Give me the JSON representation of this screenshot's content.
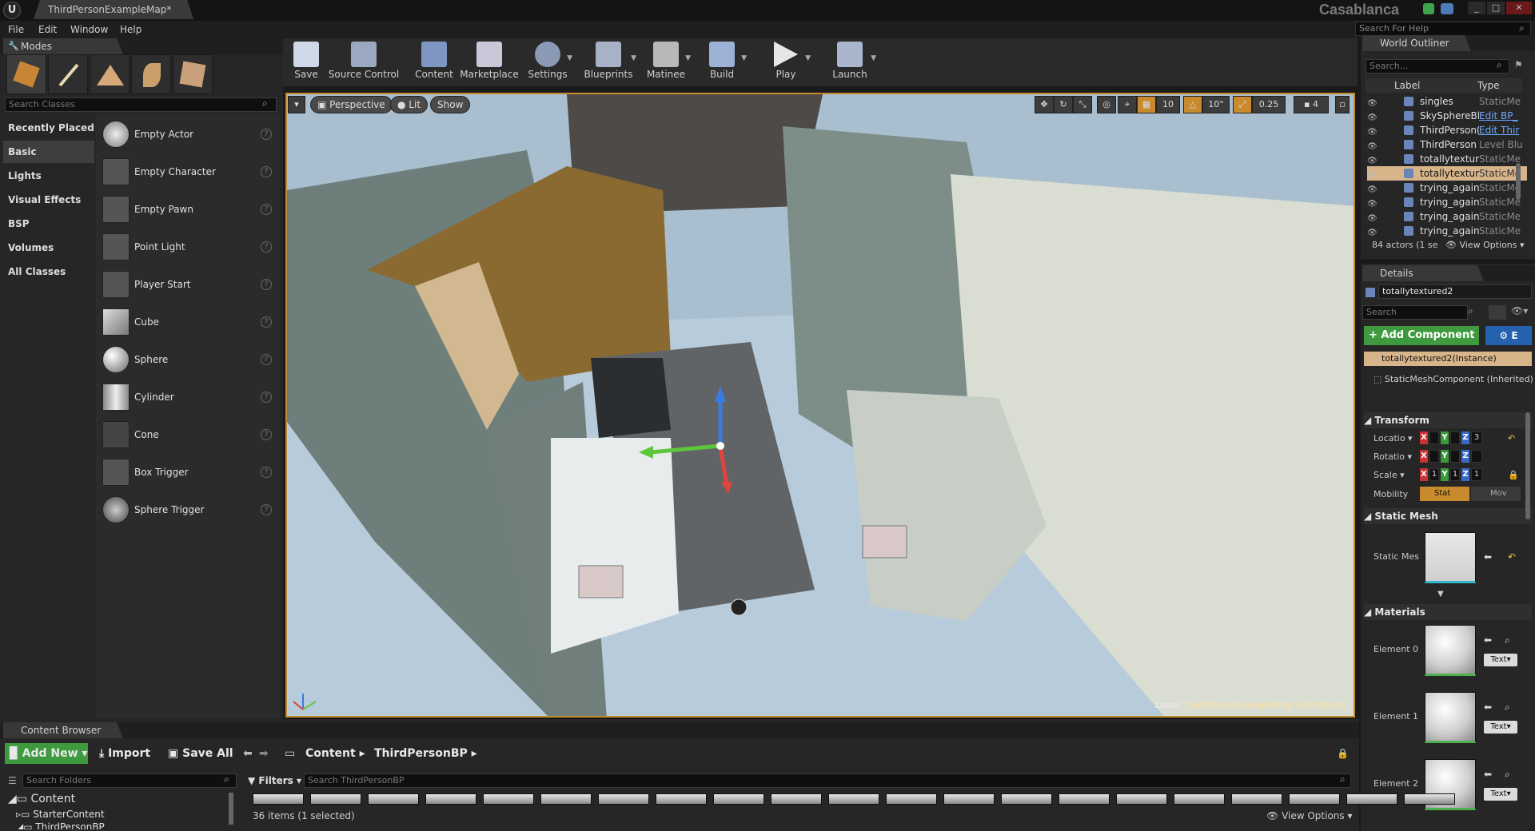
{
  "titlebar": {
    "logo": "U",
    "doc_tab": "ThirdPersonExampleMap*",
    "project": "Casablanca",
    "win_min": "_",
    "win_max": "□",
    "win_close": "✕"
  },
  "menu": {
    "items": [
      "File",
      "Edit",
      "Window",
      "Help"
    ],
    "search_placeholder": "Search For Help"
  },
  "modes": {
    "tab": "Modes",
    "search_placeholder": "Search Classes",
    "categories": [
      "Recently Placed",
      "Basic",
      "Lights",
      "Visual Effects",
      "BSP",
      "Volumes",
      "All Classes"
    ],
    "items": [
      "Empty Actor",
      "Empty Character",
      "Empty Pawn",
      "Point Light",
      "Player Start",
      "Cube",
      "Sphere",
      "Cylinder",
      "Cone",
      "Box Trigger",
      "Sphere Trigger"
    ],
    "help": "?"
  },
  "toolbar": {
    "buttons": [
      "Save",
      "Source Control",
      "Content",
      "Marketplace",
      "Settings",
      "Blueprints",
      "Matinee",
      "Build",
      "Play",
      "Launch"
    ]
  },
  "viewport": {
    "perspective": "Perspective",
    "lit": "Lit",
    "show": "Show",
    "grid_snap": "10",
    "rot_snap": "10°",
    "scale_snap": "0.25",
    "cam_speed": "4",
    "level_label": "Level:",
    "level_name": "ThirdPersonExampleMap (Persistent)"
  },
  "outliner": {
    "tab": "World Outliner",
    "search_placeholder": "Search...",
    "col_label": "Label",
    "col_type": "Type",
    "rows": [
      {
        "name": "singles",
        "type": "StaticMe"
      },
      {
        "name": "SkySphereBl",
        "type": "Edit BP_"
      },
      {
        "name": "ThirdPerson(",
        "type": "Edit Thir"
      },
      {
        "name": "ThirdPerson",
        "type": "Level Blu"
      },
      {
        "name": "totallytexture",
        "type": "StaticMe"
      },
      {
        "name": "totallytexture",
        "type": "StaticMe"
      },
      {
        "name": "trying_again",
        "type": "StaticMe"
      },
      {
        "name": "trying_again",
        "type": "StaticMe"
      },
      {
        "name": "trying_again",
        "type": "StaticMe"
      },
      {
        "name": "trying_again",
        "type": "StaticMe"
      }
    ],
    "selected_index": 5,
    "footer": "84 actors (1 se",
    "view_options": "View Options"
  },
  "details": {
    "tab": "Details",
    "object_name": "totallytextured2",
    "search_placeholder": "Search",
    "add_component": "+ Add Component",
    "blueprint_btn": "E",
    "components": [
      "totallytextured2(Instance)",
      "StaticMeshComponent (Inherited)"
    ],
    "transform": {
      "header": "Transform",
      "location": "Locatio",
      "rotation": "Rotatio",
      "scale": "Scale",
      "mobility": "Mobility",
      "loc_z": "3",
      "scale_x": "1",
      "scale_y": "1",
      "scale_z": "1",
      "mob_static": "Stat",
      "mob_movable": "Mov"
    },
    "static_mesh": {
      "header": "Static Mesh",
      "label": "Static Mes"
    },
    "materials": {
      "header": "Materials",
      "elements": [
        "Element 0",
        "Element 1",
        "Element 2"
      ],
      "text_btn": "Text"
    }
  },
  "content_browser": {
    "tab": "Content Browser",
    "add_new": "Add New",
    "import": "Import",
    "save_all": "Save All",
    "path": [
      "Content",
      "ThirdPersonBP"
    ],
    "folder_search": "Search Folders",
    "filters": "Filters",
    "asset_search": "Search ThirdPersonBP",
    "tree": [
      "Content",
      "StarterContent",
      "ThirdPersonBP"
    ],
    "count": "36 items (1 selected)",
    "view_options": "View Options"
  }
}
